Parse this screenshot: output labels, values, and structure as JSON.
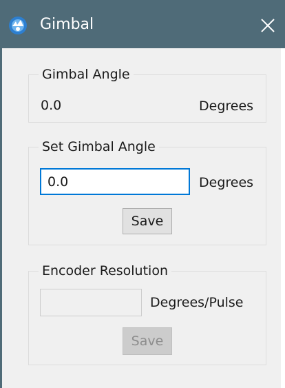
{
  "window": {
    "title": "Gimbal",
    "close_symbol": "✕"
  },
  "gimbal_angle": {
    "legend": "Gimbal Angle",
    "value": "0.0",
    "unit": "Degrees"
  },
  "set_gimbal_angle": {
    "legend": "Set Gimbal Angle",
    "input_value": "0.0",
    "unit": "Degrees",
    "save_label": "Save"
  },
  "encoder_resolution": {
    "legend": "Encoder Resolution",
    "input_value": "",
    "unit": "Degrees/Pulse",
    "save_label": "Save"
  },
  "colors": {
    "titlebar": "#4f6b78",
    "focus_border": "#0078d7",
    "client_background": "#f0f0f0"
  }
}
